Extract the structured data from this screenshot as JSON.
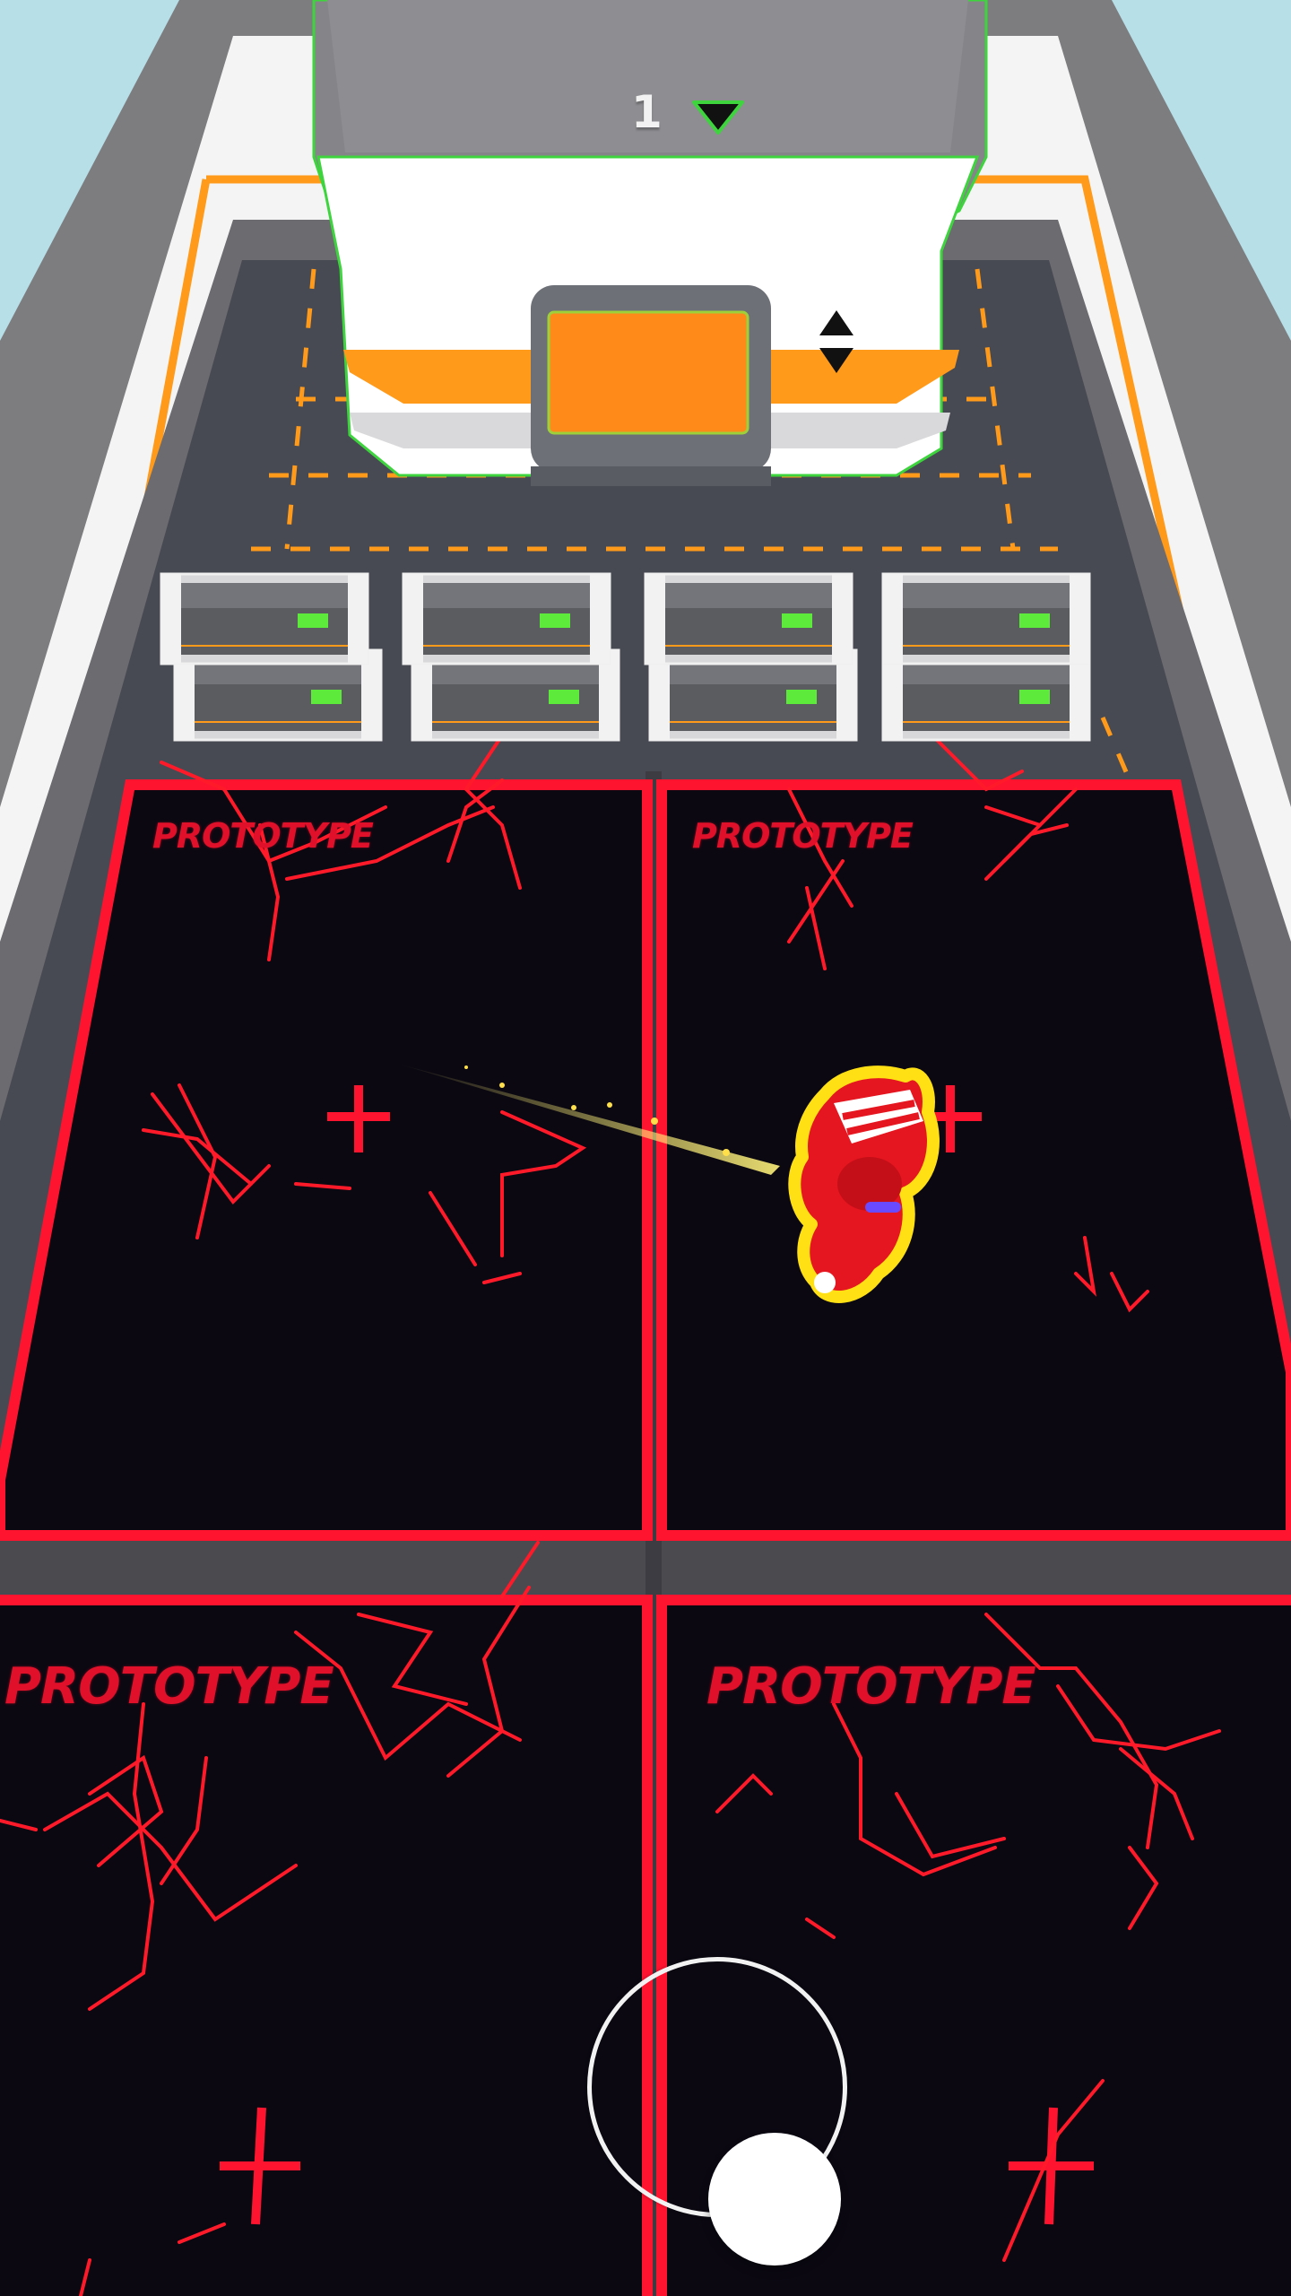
{
  "level": {
    "number": "1",
    "indicator_icon": "triangle-down-icon"
  },
  "upgrade_arrows_icon": "up-down-arrows-icon",
  "plots": [
    {
      "label": "PROTOTYPE"
    },
    {
      "label": "PROTOTYPE"
    },
    {
      "label": "PROTOTYPE"
    },
    {
      "label": "PROTOTYPE"
    }
  ],
  "crates": {
    "rows": 2,
    "per_row": 4
  },
  "joystick": {
    "knob_icon": "joystick-knob"
  },
  "colors": {
    "sky": "#b7dfe8",
    "plot_border": "#ff1430",
    "plot_fill": "#0b0812",
    "accent_orange": "#ff9a1a",
    "machine_outline": "#3ed43e",
    "crate_led": "#5eea3a",
    "player_outline": "#ffe014",
    "player_body": "#e5161f"
  }
}
